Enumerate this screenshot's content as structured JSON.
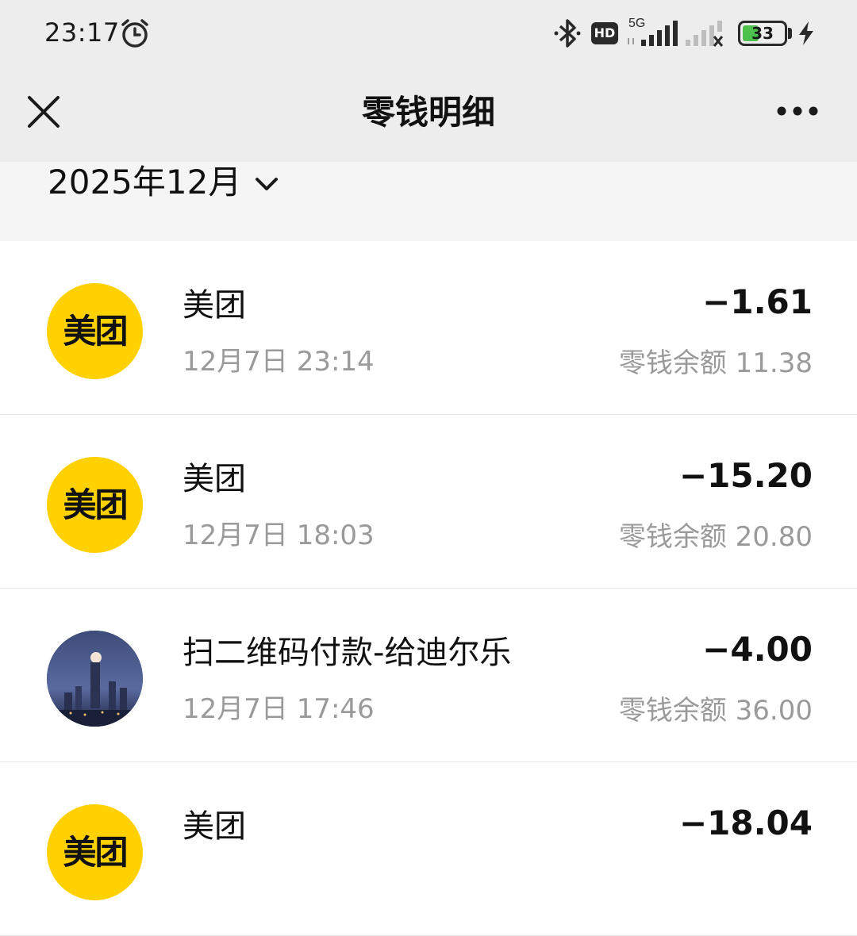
{
  "status_bar": {
    "time": "23:17",
    "network": "5G",
    "hd_badge": "HD",
    "battery_level": "33",
    "icons": [
      "alarm-icon",
      "bluetooth-icon",
      "hd-icon",
      "signal-5g-icon",
      "signal-no-service-icon",
      "battery-icon",
      "charging-bolt-icon"
    ]
  },
  "header": {
    "title": "零钱明细",
    "close_icon": "close-icon",
    "more_icon": "more-icon"
  },
  "month_selector": {
    "label": "2025年12月",
    "icon": "chevron-down-icon"
  },
  "transactions": [
    {
      "title": "美团",
      "time": "12月7日 23:14",
      "amount": "−1.61",
      "balance": "零钱余额 11.38",
      "avatar_text": "美团",
      "avatar": "meituan-logo"
    },
    {
      "title": "美团",
      "time": "12月7日 18:03",
      "amount": "−15.20",
      "balance": "零钱余额 20.80",
      "avatar_text": "美团",
      "avatar": "meituan-logo"
    },
    {
      "title": "扫二维码付款-给迪尔乐",
      "time": "12月7日 17:46",
      "amount": "−4.00",
      "balance": "零钱余额 36.00",
      "avatar": "city-night-photo"
    },
    {
      "title": "美团",
      "time": "",
      "amount": "−18.04",
      "balance": "",
      "avatar_text": "美团",
      "avatar": "meituan-logo"
    }
  ],
  "colors": {
    "header_bg": "#ededed",
    "month_bar_bg": "#f5f5f5",
    "meituan_yellow": "#ffd100",
    "secondary_text": "#9a9a9a",
    "battery_green": "#4cc24c"
  }
}
